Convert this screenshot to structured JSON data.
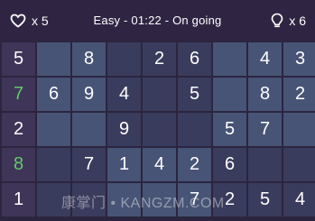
{
  "topbar": {
    "lives_count": "x 5",
    "status": "Easy - 01:22 - On going",
    "hints_count": "x 6",
    "lives_icon": "heart-icon",
    "hints_icon": "lightbulb-icon"
  },
  "board": {
    "rows": [
      [
        "5",
        "",
        "8",
        "",
        "2",
        "6",
        "",
        "4",
        "3"
      ],
      [
        "7",
        "6",
        "9",
        "4",
        "",
        "5",
        "",
        "8",
        "2"
      ],
      [
        "2",
        "",
        "",
        "9",
        "",
        "",
        "5",
        "7",
        ""
      ],
      [
        "8",
        "",
        "7",
        "1",
        "4",
        "2",
        "6",
        "",
        ""
      ],
      [
        "1",
        "",
        "",
        "",
        "",
        "7",
        "2",
        "5",
        "4"
      ]
    ],
    "green_cells": [
      [
        1,
        0
      ],
      [
        3,
        0
      ]
    ]
  },
  "watermark": "康掌门 • KANGZM.COM"
}
